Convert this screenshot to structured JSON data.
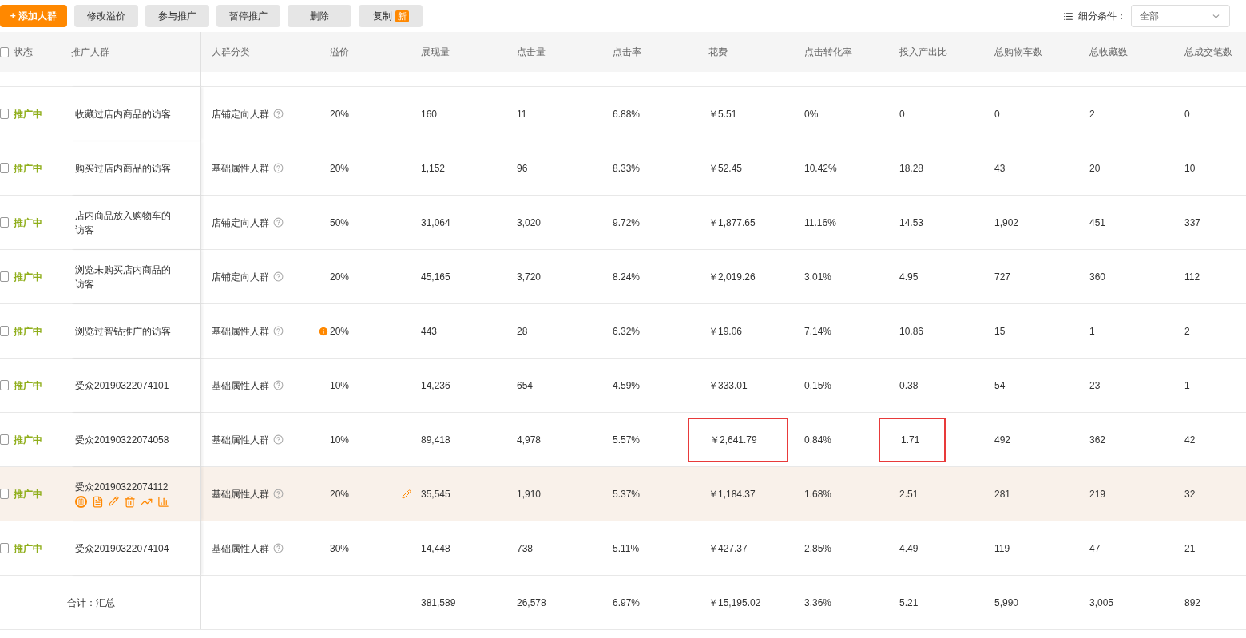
{
  "toolbar": {
    "buttons": [
      {
        "label": "+ 添加人群",
        "primary": true
      },
      {
        "label": "修改溢价",
        "primary": false
      },
      {
        "label": "参与推广",
        "primary": false
      },
      {
        "label": "暂停推广",
        "primary": false
      },
      {
        "label": "删除",
        "primary": false
      },
      {
        "label": "复制",
        "primary": false,
        "badge": "新"
      }
    ],
    "filter": {
      "label": "细分条件：",
      "value": "全部"
    }
  },
  "table": {
    "select_all_checked": false,
    "columns": [
      "状态",
      "推广人群",
      "人群分类",
      "溢价",
      "展现量",
      "点击量",
      "点击率",
      "花费",
      "点击转化率",
      "投入产出比",
      "总购物车数",
      "总收藏数",
      "总成交笔数"
    ],
    "rows": [
      {
        "checked": false,
        "status": "推广中",
        "audience": "收藏过店内商品的访客",
        "category": "店铺定向人群",
        "premium": "20%",
        "premium_warning": false,
        "hovered": false,
        "spend_boxed": false,
        "roi_boxed": false,
        "metrics": [
          "160",
          "11",
          "6.88%",
          "￥5.51",
          "0%",
          "0",
          "0",
          "2",
          "0"
        ]
      },
      {
        "checked": false,
        "status": "推广中",
        "audience": "购买过店内商品的访客",
        "category": "基础属性人群",
        "premium": "20%",
        "premium_warning": false,
        "hovered": false,
        "spend_boxed": false,
        "roi_boxed": false,
        "metrics": [
          "1,152",
          "96",
          "8.33%",
          "￥52.45",
          "10.42%",
          "18.28",
          "43",
          "20",
          "10"
        ]
      },
      {
        "checked": false,
        "status": "推广中",
        "audience": "店内商品放入购物车的访客",
        "category": "店铺定向人群",
        "premium": "50%",
        "premium_warning": false,
        "hovered": false,
        "spend_boxed": false,
        "roi_boxed": false,
        "metrics": [
          "31,064",
          "3,020",
          "9.72%",
          "￥1,877.65",
          "11.16%",
          "14.53",
          "1,902",
          "451",
          "337"
        ]
      },
      {
        "checked": false,
        "status": "推广中",
        "audience": "浏览未购买店内商品的访客",
        "category": "店铺定向人群",
        "premium": "20%",
        "premium_warning": false,
        "hovered": false,
        "spend_boxed": false,
        "roi_boxed": false,
        "metrics": [
          "45,165",
          "3,720",
          "8.24%",
          "￥2,019.26",
          "3.01%",
          "4.95",
          "727",
          "360",
          "112"
        ]
      },
      {
        "checked": false,
        "status": "推广中",
        "audience": "浏览过智钻推广的访客",
        "category": "基础属性人群",
        "premium": "20%",
        "premium_warning": true,
        "hovered": false,
        "spend_boxed": false,
        "roi_boxed": false,
        "metrics": [
          "443",
          "28",
          "6.32%",
          "￥19.06",
          "7.14%",
          "10.86",
          "15",
          "1",
          "2"
        ]
      },
      {
        "checked": false,
        "status": "推广中",
        "audience": "受众20190322074101",
        "category": "基础属性人群",
        "premium": "10%",
        "premium_warning": false,
        "hovered": false,
        "spend_boxed": false,
        "roi_boxed": false,
        "metrics": [
          "14,236",
          "654",
          "4.59%",
          "￥333.01",
          "0.15%",
          "0.38",
          "54",
          "23",
          "1"
        ]
      },
      {
        "checked": false,
        "status": "推广中",
        "audience": "受众20190322074058",
        "category": "基础属性人群",
        "premium": "10%",
        "premium_warning": false,
        "hovered": false,
        "spend_boxed": true,
        "roi_boxed": true,
        "metrics": [
          "89,418",
          "4,978",
          "5.57%",
          "￥2,641.79",
          "0.84%",
          "1.71",
          "492",
          "362",
          "42"
        ]
      },
      {
        "checked": false,
        "status": "推广中",
        "audience": "受众20190322074112",
        "category": "基础属性人群",
        "premium": "20%",
        "premium_warning": false,
        "hovered": true,
        "spend_boxed": false,
        "roi_boxed": false,
        "metrics": [
          "35,545",
          "1,910",
          "5.37%",
          "￥1,184.37",
          "1.68%",
          "2.51",
          "281",
          "219",
          "32"
        ]
      },
      {
        "checked": false,
        "status": "推广中",
        "audience": "受众20190322074104",
        "category": "基础属性人群",
        "premium": "30%",
        "premium_warning": false,
        "hovered": false,
        "spend_boxed": false,
        "roi_boxed": false,
        "metrics": [
          "14,448",
          "738",
          "5.11%",
          "￥427.37",
          "2.85%",
          "4.49",
          "119",
          "47",
          "21"
        ]
      }
    ],
    "total": {
      "label": "合计：汇总",
      "metrics": [
        "381,589",
        "26,578",
        "6.97%",
        "￥15,195.02",
        "3.36%",
        "5.21",
        "5,990",
        "3,005",
        "892"
      ]
    }
  }
}
